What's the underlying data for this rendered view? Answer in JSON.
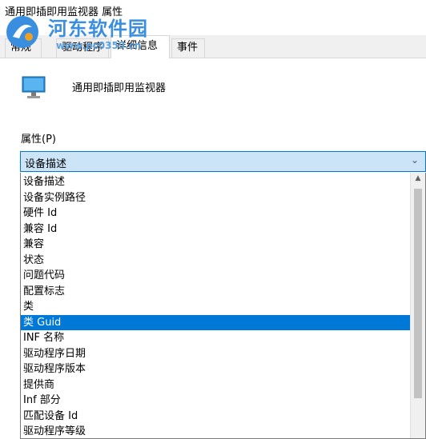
{
  "window": {
    "title": "通用即插即用监视器 属性"
  },
  "watermark": {
    "text": "河东软件园",
    "url": "www.pc0359.cn"
  },
  "tabs": [
    {
      "label": "常规"
    },
    {
      "label": "驱动程序"
    },
    {
      "label": "详细信息"
    },
    {
      "label": "事件"
    }
  ],
  "device": {
    "name": "通用即插即用监视器",
    "icon": "monitor-icon"
  },
  "property": {
    "label": "属性(P)",
    "selected": "设备描述",
    "options": [
      "设备描述",
      "设备实例路径",
      "硬件 Id",
      "兼容 Id",
      "兼容",
      "状态",
      "问题代码",
      "配置标志",
      "类",
      "类 Guid",
      "INF 名称",
      "驱动程序日期",
      "驱动程序版本",
      "提供商",
      "Inf 部分",
      "匹配设备 Id",
      "驱动程序等级"
    ],
    "highlighted_index": 9
  },
  "colors": {
    "selection": "#0078d7",
    "combo_bg": "#cce4f7",
    "watermark": "#3a8ee0"
  }
}
